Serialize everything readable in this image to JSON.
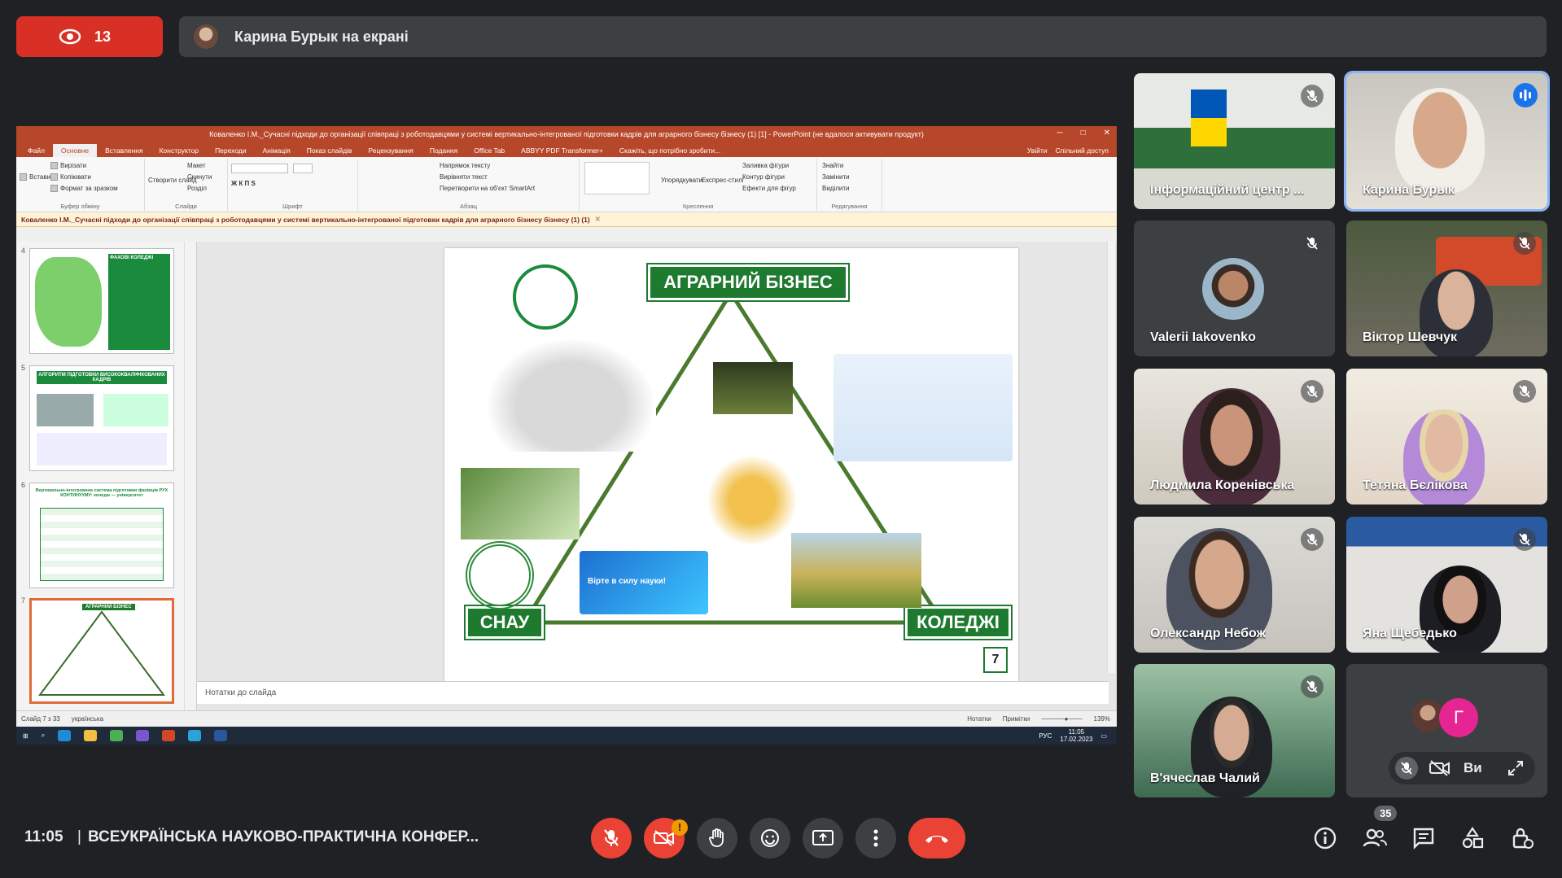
{
  "top": {
    "viewer_count": "13",
    "presenter_text": "Карина Бурык на екрані"
  },
  "ppt": {
    "window_title": "Коваленко І.М._Сучасні підходи до організації співпраці з роботодавцями у системі вертикально-інтегрованої підготовки кадрів для аграрного бізнесу бізнесу (1) [1] - PowerPoint (не вдалося активувати продукт)",
    "tabs": [
      "Файл",
      "Основне",
      "Вставлення",
      "Конструктор",
      "Переходи",
      "Анімація",
      "Показ слайдів",
      "Рецензування",
      "Подання",
      "Office Tab",
      "ABBYY PDF Transformer+",
      "Скажіть, що потрібно зробити..."
    ],
    "tabs_right": [
      "Увійти",
      "Спільний доступ"
    ],
    "ribbon_groups": [
      "Буфер обміну",
      "Слайди",
      "Шрифт",
      "Абзац",
      "Креслення",
      "Редагування"
    ],
    "ribbon_buttons": {
      "paste": "Вставити",
      "cut": "Вирізати",
      "copy": "Копіювати",
      "format_painter": "Формат за зразком",
      "new_slide": "Створити слайд",
      "layout": "Макет",
      "reset": "Скинути",
      "section": "Розділ",
      "text_direction": "Напрямок тексту",
      "align_text": "Вирівняти текст",
      "smartart": "Перетворити на об'єкт SmartArt",
      "arrange": "Упорядкувати",
      "quick_styles": "Експрес-стилі",
      "shape_fill": "Заливка фігури",
      "shape_outline": "Контур фігури",
      "shape_effects": "Ефекти для фігур",
      "find": "Знайти",
      "replace": "Замінити",
      "select": "Виділити"
    },
    "doc_tab": "Коваленко І.М._Сучасні підходи до організації співпраці з роботодавцями у системі вертикально-інтегрованої підготовки кадрів для аграрного бізнесу бізнесу (1) (1)",
    "thumbs": [
      {
        "num": "4",
        "title": "ФАХОВІ КОЛЕДЖІ"
      },
      {
        "num": "5",
        "title": "АЛГОРИТМ ПІДГОТОВКИ ВИСОКОКВАЛІФІКОВАНИХ КАДРІВ"
      },
      {
        "num": "6",
        "title": "Вертикально-інтегрована система підготовки фахівців РУХ КОНТИНУУМУ: коледж — університет"
      },
      {
        "num": "7",
        "title": "АГРАРНИЙ БІЗНЕС"
      }
    ],
    "slide": {
      "top_label": "АГРАРНИЙ БІЗНЕС",
      "left_label": "СНАУ",
      "right_label": "КОЛЕДЖІ",
      "page_num": "7",
      "science_text": "Вірте в силу науки!"
    },
    "notes_placeholder": "Нотатки до слайда",
    "status": {
      "slide_info": "Слайд 7 з 33",
      "language": "українська",
      "notes_btn": "Нотатки",
      "comments_btn": "Примітки",
      "zoom": "139%"
    },
    "taskbar": {
      "lang": "РУС",
      "time": "11:05",
      "date": "17.02.2023"
    }
  },
  "participants": [
    {
      "name": "Інформаційний центр ...",
      "muted": true
    },
    {
      "name": "Карина Бурык",
      "muted": false,
      "speaking": true
    },
    {
      "name": "Valerii Iakovenko",
      "muted": true
    },
    {
      "name": "Віктор Шевчук",
      "muted": true
    },
    {
      "name": "Людмила Коренівська",
      "muted": true
    },
    {
      "name": "Тетяна Бєлікова",
      "muted": true
    },
    {
      "name": "Олександр Небож",
      "muted": true
    },
    {
      "name": "Яна Щебедько",
      "muted": true
    },
    {
      "name": "В'ячеслав Чалий",
      "muted": true
    }
  ],
  "self_tile": {
    "label": "Ви",
    "other_initial": "Г"
  },
  "bottom": {
    "time": "11:05",
    "meeting_title": "ВСЕУКРАЇНСЬКА НАУКОВО-ПРАКТИЧНА КОНФЕР...",
    "camera_warning": "!",
    "people_count": "35"
  },
  "colors": {
    "red": "#ea4335",
    "dark": "#202124",
    "tile": "#3c4043",
    "slide_green": "#1e7a2f",
    "ppt_accent": "#b7472a"
  }
}
